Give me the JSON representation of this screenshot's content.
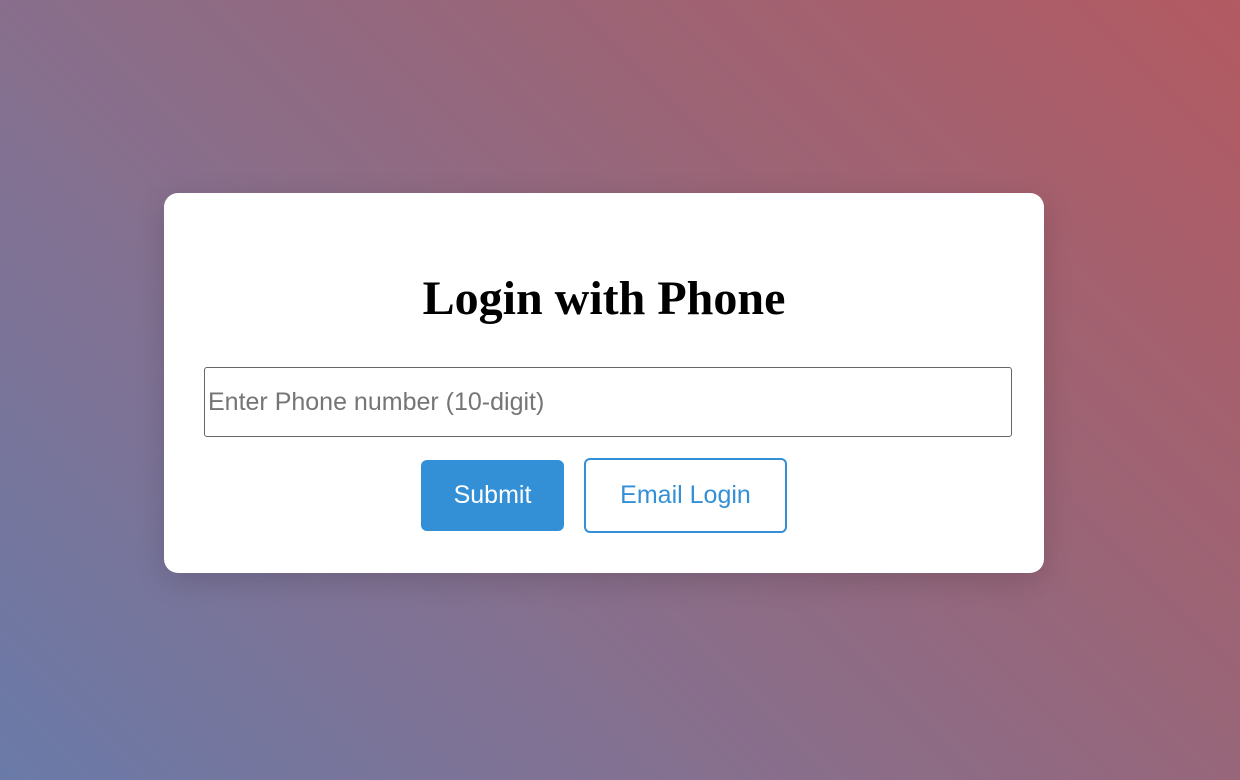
{
  "login_card": {
    "title": "Login with Phone",
    "phone_input": {
      "placeholder": "Enter Phone number (10-digit)",
      "value": ""
    },
    "submit_label": "Submit",
    "email_login_label": "Email Login"
  },
  "colors": {
    "accent": "#3390d6",
    "card_background": "#ffffff",
    "background_gradient": [
      "#6a7aa8",
      "#85708f",
      "#9a6577",
      "#b35a62"
    ]
  }
}
